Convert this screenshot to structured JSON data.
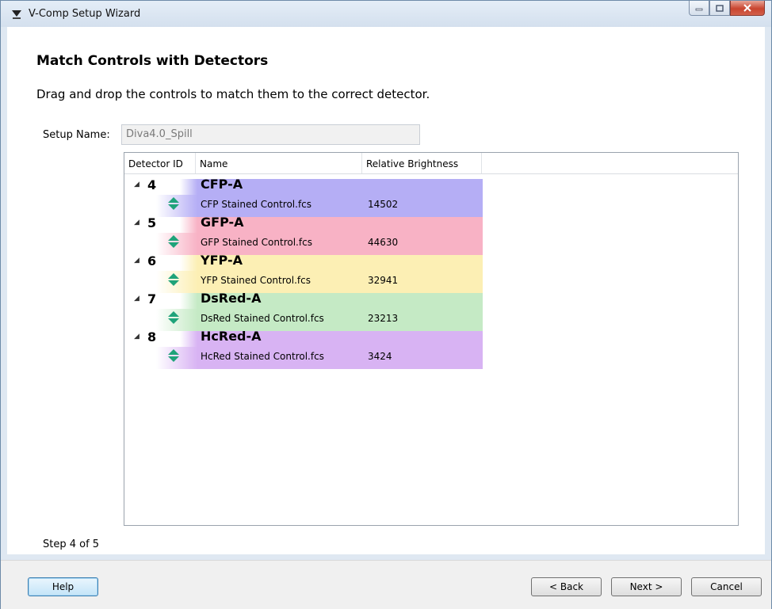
{
  "window": {
    "title": "V-Comp Setup Wizard"
  },
  "heading": "Match Controls with Detectors",
  "instruction": "Drag and drop the controls to match them to the correct detector.",
  "setup": {
    "label": "Setup Name:",
    "value": "Diva4.0_Spill"
  },
  "grid": {
    "headers": [
      "Detector ID",
      "Name",
      "Relative Brightness"
    ],
    "groups": [
      {
        "id": "4",
        "detector": "CFP-A",
        "control": "CFP Stained Control.fcs",
        "brightness": "14502",
        "color": "#b5aef5"
      },
      {
        "id": "5",
        "detector": "GFP-A",
        "control": "GFP Stained Control.fcs",
        "brightness": "44630",
        "color": "#f8b2c5"
      },
      {
        "id": "6",
        "detector": "YFP-A",
        "control": "YFP Stained Control.fcs",
        "brightness": "32941",
        "color": "#fcefb4"
      },
      {
        "id": "7",
        "detector": "DsRed-A",
        "control": "DsRed Stained Control.fcs",
        "brightness": "23213",
        "color": "#c5eac5"
      },
      {
        "id": "8",
        "detector": "HcRed-A",
        "control": "HcRed Stained Control.fcs",
        "brightness": "3424",
        "color": "#d8b3f3"
      }
    ]
  },
  "step": "Step 4 of 5",
  "buttons": {
    "help": "Help",
    "back": "< Back",
    "next": "Next >",
    "cancel": "Cancel"
  },
  "icons": {
    "expander": "expander-triangle-icon",
    "drag": "drag-handle-icon",
    "app": "app-logo-icon"
  },
  "colors": {
    "drag_icon": "#1fa37a",
    "accent": "#3c7fb1"
  }
}
